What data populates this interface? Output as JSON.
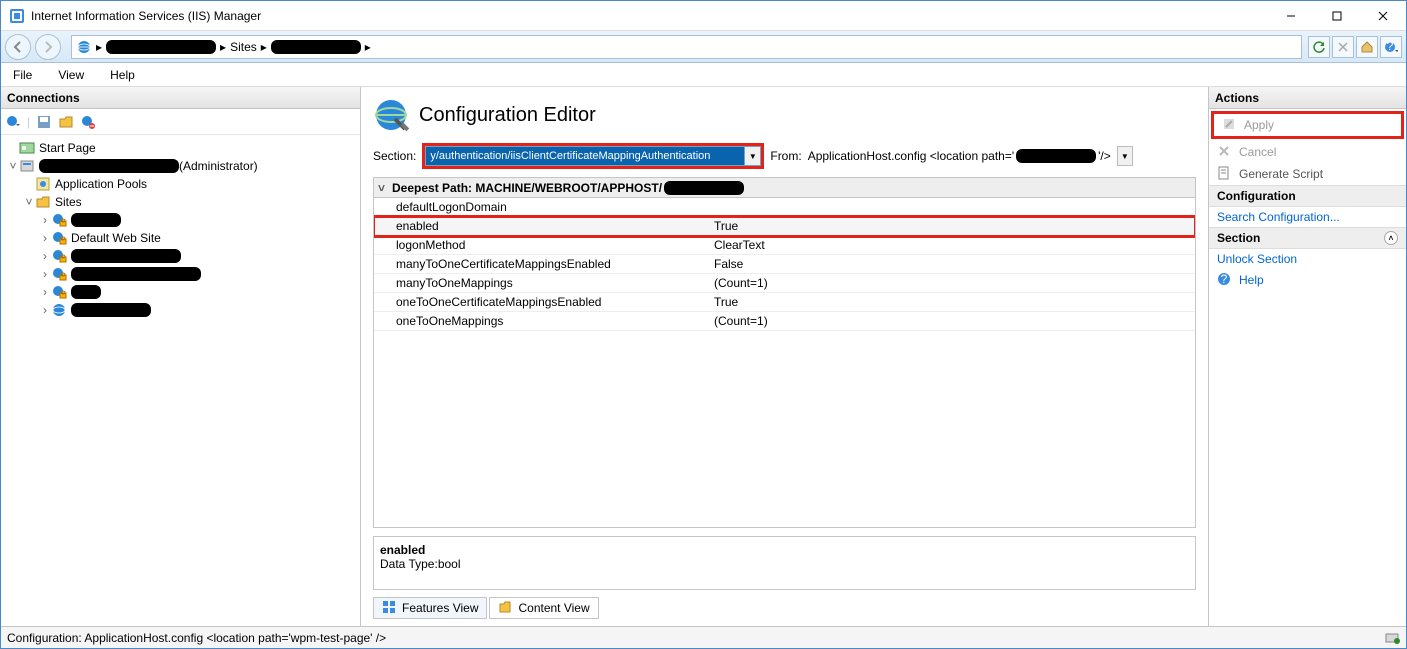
{
  "window": {
    "title": "Internet Information Services (IIS) Manager"
  },
  "breadcrumb": {
    "level1_redacted": true,
    "level2": "Sites",
    "level3_redacted": true
  },
  "menu": {
    "file": "File",
    "view": "View",
    "help": "Help"
  },
  "connections": {
    "title": "Connections",
    "items": {
      "start_page": "Start Page",
      "server_suffix": "(Administrator)",
      "app_pools": "Application Pools",
      "sites": "Sites",
      "default_site": "Default Web Site"
    }
  },
  "editor": {
    "title": "Configuration Editor",
    "section_label": "Section:",
    "section_value": "y/authentication/iisClientCertificateMappingAuthentication",
    "from_label": "From:",
    "from_prefix": "ApplicationHost.config <location path='",
    "from_suffix": "'/>",
    "deepest_path_label": "Deepest Path: MACHINE/WEBROOT/APPHOST/",
    "props": [
      {
        "k": "defaultLogonDomain",
        "v": ""
      },
      {
        "k": "enabled",
        "v": "True",
        "hl": true
      },
      {
        "k": "logonMethod",
        "v": "ClearText"
      },
      {
        "k": "manyToOneCertificateMappingsEnabled",
        "v": "False"
      },
      {
        "k": "manyToOneMappings",
        "v": "(Count=1)"
      },
      {
        "k": "oneToOneCertificateMappingsEnabled",
        "v": "True"
      },
      {
        "k": "oneToOneMappings",
        "v": "(Count=1)"
      }
    ],
    "desc_title": "enabled",
    "desc_body": "Data Type:bool"
  },
  "viewtabs": {
    "features": "Features View",
    "content": "Content View"
  },
  "actions": {
    "title": "Actions",
    "apply": "Apply",
    "cancel": "Cancel",
    "gen_script": "Generate Script",
    "config_hdr": "Configuration",
    "search_config": "Search Configuration...",
    "section_hdr": "Section",
    "unlock": "Unlock Section",
    "help": "Help"
  },
  "statusbar": {
    "text": "Configuration: ApplicationHost.config <location path='wpm-test-page' />"
  }
}
